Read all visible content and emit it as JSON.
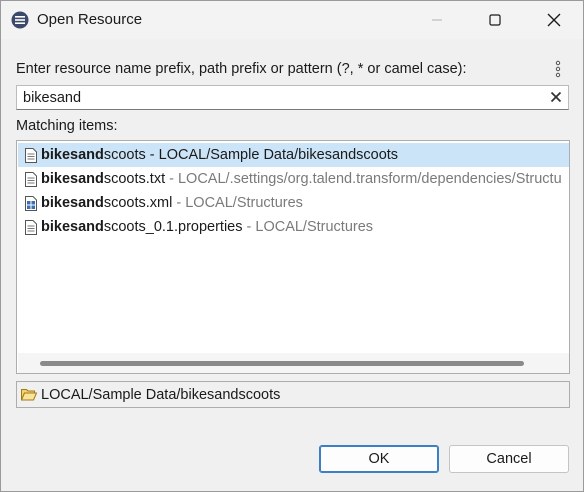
{
  "window": {
    "title": "Open Resource",
    "icon": "eclipse-app-icon"
  },
  "search": {
    "label": "Enter resource name prefix, path prefix or pattern (?, * or camel case):",
    "value": "bikesand"
  },
  "matching": {
    "label": "Matching items:",
    "items": [
      {
        "match": "bikesand",
        "rest": "scoots",
        "path": " - LOCAL/Sample Data/bikesandscoots",
        "icon": "text-file-icon",
        "selected": true
      },
      {
        "match": "bikesand",
        "rest": "scoots.txt",
        "path": " - LOCAL/.settings/org.talend.transform/dependencies/Structu",
        "icon": "text-file-icon",
        "selected": false
      },
      {
        "match": "bikesand",
        "rest": "scoots.xml",
        "path": " - LOCAL/Structures",
        "icon": "xml-file-icon",
        "selected": false
      },
      {
        "match": "bikesand",
        "rest": "scoots_0.1.properties",
        "path": " - LOCAL/Structures",
        "icon": "text-file-icon",
        "selected": false
      }
    ]
  },
  "status": {
    "path": "LOCAL/Sample Data/bikesandscoots",
    "icon": "folder-open-icon"
  },
  "buttons": {
    "ok": "OK",
    "cancel": "Cancel"
  },
  "colors": {
    "selection": "#cce4f7",
    "default_button_border": "#3c7fc4"
  }
}
